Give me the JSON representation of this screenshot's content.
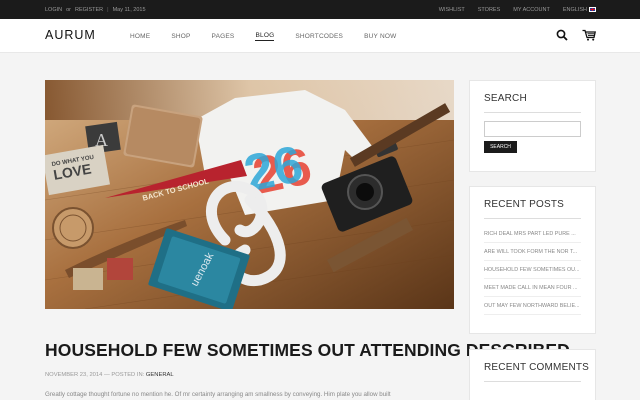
{
  "topbar": {
    "login": "LOGIN",
    "or": "or",
    "register": "REGISTER",
    "date": "May 11, 2015",
    "links": [
      "WISHLIST",
      "STORES",
      "MY ACCOUNT"
    ],
    "language": "ENGLISH"
  },
  "header": {
    "logo": "AURUM",
    "nav": [
      "HOME",
      "SHOP",
      "PAGES",
      "BLOG",
      "SHORTCODES",
      "BUY NOW"
    ],
    "active_nav": "BLOG",
    "icons": [
      "search-icon",
      "cart-icon"
    ]
  },
  "post": {
    "title": "HOUSEHOLD FEW SOMETIMES OUT ATTENDING DESCRIBED",
    "date": "NOVEMBER 23, 2014",
    "posted_in": "POSTED IN:",
    "category": "GENERAL",
    "excerpt": "Greatly cottage thought fortune no mention he. Of mr certainty arranging am smallness by conveying. Him plate you allow built"
  },
  "hero_image": {
    "pennant_text": "BACK TO SCHOOL",
    "shirt_number": "26",
    "book_text": "uenoak"
  },
  "sidebar": {
    "search": {
      "title": "SEARCH",
      "button": "SEARCH"
    },
    "recent_posts": {
      "title": "RECENT POSTS",
      "items": [
        "RICH DEAL MRS PART LED PURE ...",
        "ARE WILL TOOK FORM THE NOR T...",
        "HOUSEHOLD FEW SOMETIMES OU...",
        "MEET MADE CALL IN MEAN FOUR ...",
        "OUT MAY FEW NORTHWARD BELIE..."
      ]
    },
    "recent_comments": {
      "title": "RECENT COMMENTS"
    }
  },
  "colors": {
    "topbar_bg": "#1b1b1b",
    "page_bg": "#f4f4f4",
    "button_bg": "#1b1b1b"
  }
}
